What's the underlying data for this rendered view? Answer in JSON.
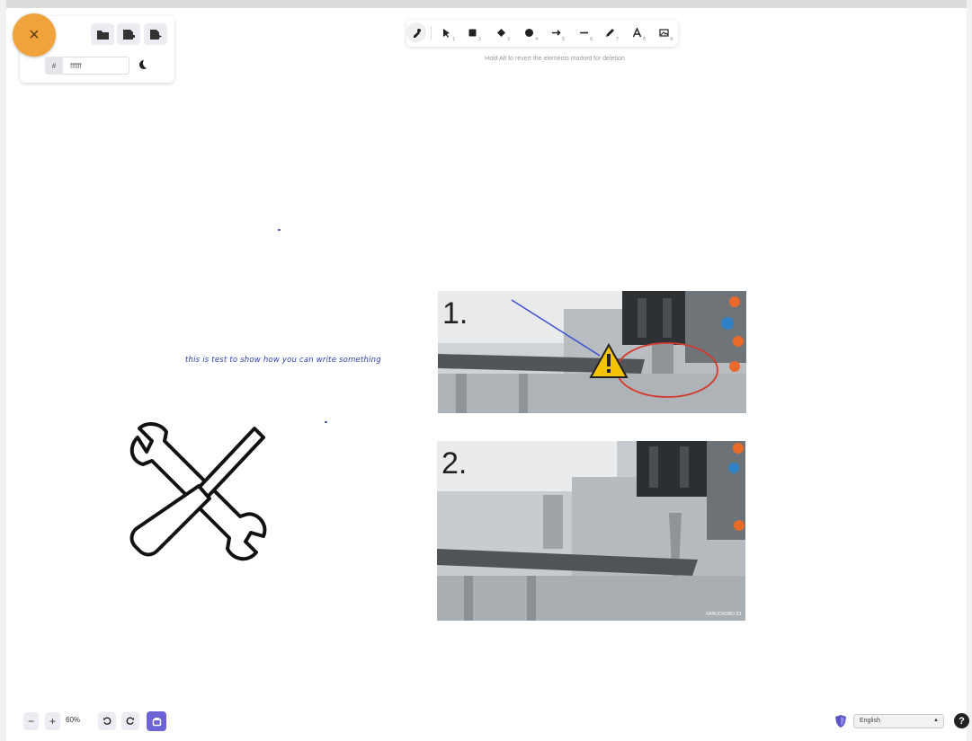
{
  "menu": {
    "close_icon": "close-icon",
    "close_label": "×",
    "file_buttons": [
      "open-icon",
      "save-icon",
      "export-icon"
    ],
    "color_hash": "#",
    "color_value": "ffffff",
    "theme_icon": "moon-icon"
  },
  "toolbar": {
    "tools": [
      {
        "name": "selection",
        "icon": "pointer-icon",
        "key": "1"
      },
      {
        "name": "rectangle",
        "icon": "square-icon",
        "key": "2"
      },
      {
        "name": "diamond",
        "icon": "diamond-icon",
        "key": "3"
      },
      {
        "name": "ellipse",
        "icon": "circle-icon",
        "key": "4"
      },
      {
        "name": "arrow",
        "icon": "arrow-icon",
        "key": "5"
      },
      {
        "name": "line",
        "icon": "line-icon",
        "key": "6"
      },
      {
        "name": "draw",
        "icon": "pencil-icon",
        "key": "7"
      },
      {
        "name": "text",
        "icon": "text-icon",
        "key": "8"
      },
      {
        "name": "image",
        "icon": "image-icon",
        "key": "9"
      }
    ],
    "hint": "Hold Alt to revert the elements marked for deletion"
  },
  "canvas": {
    "handwriting": "this is test to show how you can write something",
    "photo1_number": "1.",
    "photo2_number": "2.",
    "photo2_caption": "FANUCROBO 23"
  },
  "footer": {
    "zoom_out": "−",
    "zoom_in": "+",
    "zoom_level": "60%",
    "undo_icon": "undo-icon",
    "redo_icon": "redo-icon",
    "library_icon": "library-icon",
    "language": "English",
    "help_label": "?"
  },
  "colors": {
    "accent": "#f0a23b",
    "primary": "#6b63d6",
    "handwriting": "#2d3fb3",
    "annotation_red": "#d33a2c",
    "annotation_blue": "#3b4fd1",
    "warning_yellow": "#f5c400"
  }
}
